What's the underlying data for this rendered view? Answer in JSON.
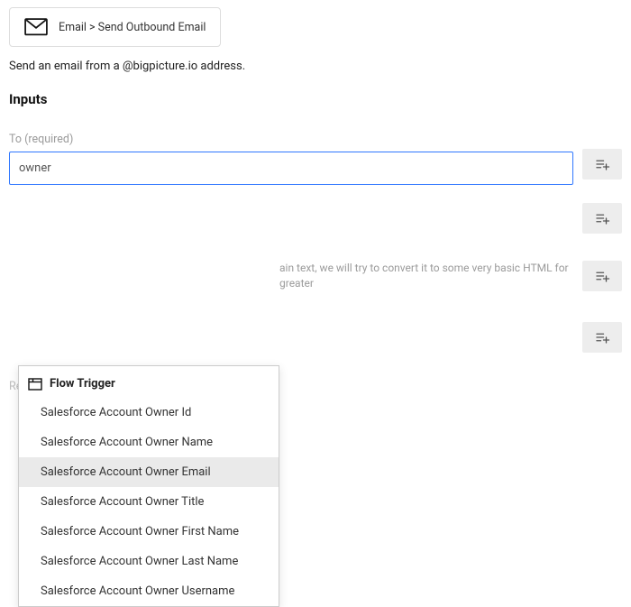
{
  "header": {
    "breadcrumb": "Email > Send Outbound Email"
  },
  "description": "Send an email from a @bigpicture.io address.",
  "inputs_heading": "Inputs",
  "fields": {
    "to": {
      "label": "To (required)",
      "value": "owner"
    },
    "body_helper": "ain text, we will try to convert it to some very basic HTML for greater",
    "reply_to": {
      "label": "Reply To (optional)"
    }
  },
  "dropdown": {
    "heading": "Flow Trigger",
    "items": [
      "Salesforce Account Owner Id",
      "Salesforce Account Owner Name",
      "Salesforce Account Owner Email",
      "Salesforce Account Owner Title",
      "Salesforce Account Owner First Name",
      "Salesforce Account Owner Last Name",
      "Salesforce Account Owner Username"
    ],
    "selected_index": 2
  }
}
